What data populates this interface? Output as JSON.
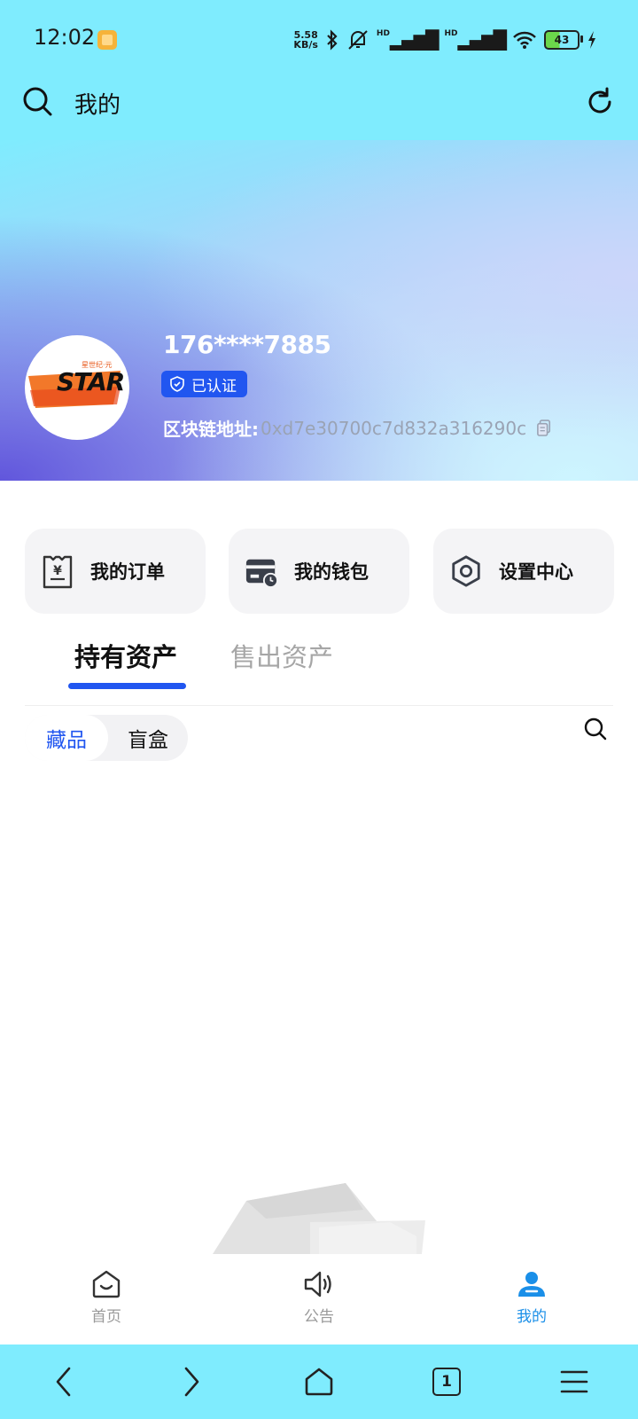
{
  "status_bar": {
    "time": "12:02",
    "net_speed_value": "5.58",
    "net_speed_unit": "KB/s",
    "signal_1": "HD",
    "signal_2": "HD",
    "battery": "43"
  },
  "header": {
    "title": "我的",
    "search_icon": "search-icon",
    "refresh_icon": "refresh-icon"
  },
  "profile": {
    "avatar_text": "STAR",
    "avatar_subtext": "星世纪·元",
    "username": "176****7885",
    "verified_label": "已认证",
    "chain_label": "区块链地址:",
    "chain_address": "0xd7e30700c7d832a316290c"
  },
  "quick_actions": [
    {
      "label": "我的订单",
      "icon": "receipt-icon"
    },
    {
      "label": "我的钱包",
      "icon": "wallet-icon"
    },
    {
      "label": "设置中心",
      "icon": "settings-hex-icon"
    }
  ],
  "asset_tabs": [
    {
      "label": "持有资产",
      "active": true
    },
    {
      "label": "售出资产",
      "active": false
    }
  ],
  "sub_tabs": [
    {
      "label": "藏品",
      "active": true
    },
    {
      "label": "盲盒",
      "active": false
    }
  ],
  "bottom_nav": [
    {
      "label": "首页",
      "icon": "home-smile-icon",
      "active": false
    },
    {
      "label": "公告",
      "icon": "speaker-icon",
      "active": false
    },
    {
      "label": "我的",
      "icon": "person-icon",
      "active": true
    }
  ],
  "system_nav": {
    "tab_count": "1"
  },
  "colors": {
    "accent": "#2156f0",
    "status_bar_bg": "#7fecfe",
    "active_tab_bottom": "#1a8fe8"
  }
}
